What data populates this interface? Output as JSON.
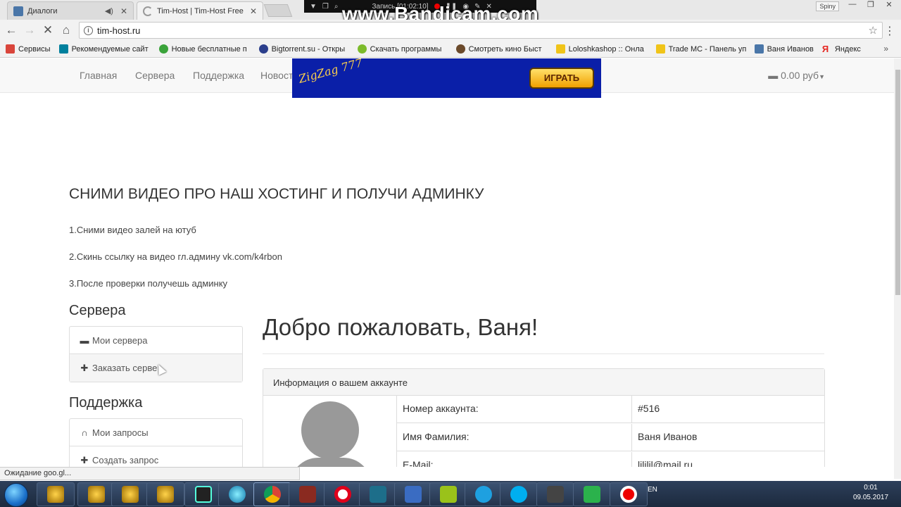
{
  "browser": {
    "tabs": [
      {
        "title": "Диалоги",
        "close": "✕"
      },
      {
        "title": "Tim-Host | Tim-Host Free",
        "close": "✕"
      }
    ],
    "url": "tim-host.ru",
    "profile": "Spiny",
    "status": "Ожидание goo.gl..."
  },
  "recorder": {
    "watermark": "www.Bandicam.com",
    "label": "Запись [01:02:10]"
  },
  "bookmarks": [
    {
      "label": "Сервисы",
      "color": "#d9453b"
    },
    {
      "label": "Рекомендуемые сайт",
      "color": "#00809d"
    },
    {
      "label": "Новые бесплатные п",
      "color": "#3aa33a"
    },
    {
      "label": "Bigtorrent.su - Откры",
      "color": "#2b3f8c"
    },
    {
      "label": "Скачать программы",
      "color": "#7cbb2b"
    },
    {
      "label": "Смотреть кино  Быст",
      "color": "#6b4a2b"
    },
    {
      "label": "Loloshkashop :: Онла",
      "color": "#f0c419"
    },
    {
      "label": "Trade MC - Панель уп",
      "color": "#f0c419"
    },
    {
      "label": "Ваня Иванов",
      "color": "#4a76a8"
    },
    {
      "label": "Яндекс",
      "color": "#e52620"
    }
  ],
  "site": {
    "nav": [
      "Главная",
      "Сервера",
      "Поддержка",
      "Новост"
    ],
    "balance": "0.00 руб",
    "ad_button": "ИГРАТЬ",
    "ad_logo": "ZigZag 777"
  },
  "promo": {
    "heading": "СНИМИ ВИДЕО ПРО НАШ ХОСТИНГ И ПОЛУЧИ АДМИНКУ",
    "steps": [
      "1.Сними видео залей на ютуб",
      "2.Скинь ссылку на видео гл.админу vk.com/k4rbon",
      "3.После проверки получешь админку"
    ]
  },
  "sidebar": {
    "servers_title": "Сервера",
    "servers_items": [
      "Мои сервера",
      "Заказать серве"
    ],
    "support_title": "Поддержка",
    "support_items": [
      "Мои запросы",
      "Создать запрос"
    ]
  },
  "main": {
    "welcome": "Добро пожаловать, Ваня!",
    "panel_title": "Информация о вашем аккаунте",
    "rows": [
      {
        "key": "Номер аккаунта:",
        "value": "#516"
      },
      {
        "key": "Имя Фамилия:",
        "value": "Ваня Иванов"
      },
      {
        "key": "E-Mail:",
        "value": "ljljljl@mail.ru"
      }
    ]
  },
  "taskbar": {
    "lang": "EN",
    "time": "0:01",
    "date": "09.05.2017"
  }
}
